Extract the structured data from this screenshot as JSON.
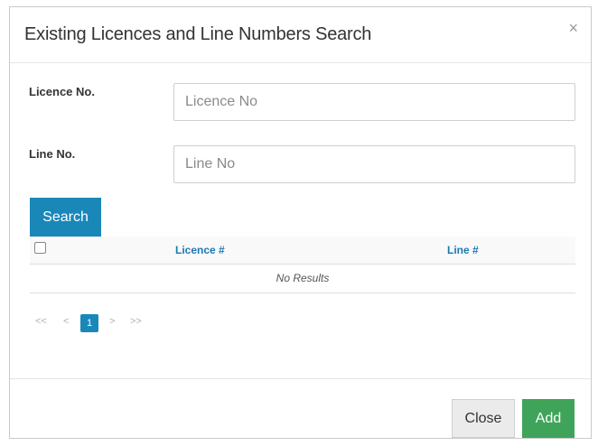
{
  "modal": {
    "title": "Existing Licences and Line Numbers Search",
    "close_icon": "×"
  },
  "form": {
    "licence": {
      "label": "Licence No.",
      "placeholder": "Licence No",
      "value": ""
    },
    "line": {
      "label": "Line No.",
      "placeholder": "Line No",
      "value": ""
    },
    "search_label": "Search"
  },
  "table": {
    "columns": [
      "Licence #",
      "Line #"
    ],
    "empty_text": "No Results",
    "select_all_checked": false
  },
  "pagination": {
    "first": "<<",
    "prev": "<",
    "current": "1",
    "next": ">",
    "last": ">>"
  },
  "footer": {
    "close_label": "Close",
    "add_label": "Add"
  },
  "colors": {
    "primary": "#1a87b9",
    "success": "#3fa45a",
    "link": "#1a7ab5"
  },
  "icons": {
    "close": "close-icon",
    "checkbox": "checkbox-icon"
  }
}
